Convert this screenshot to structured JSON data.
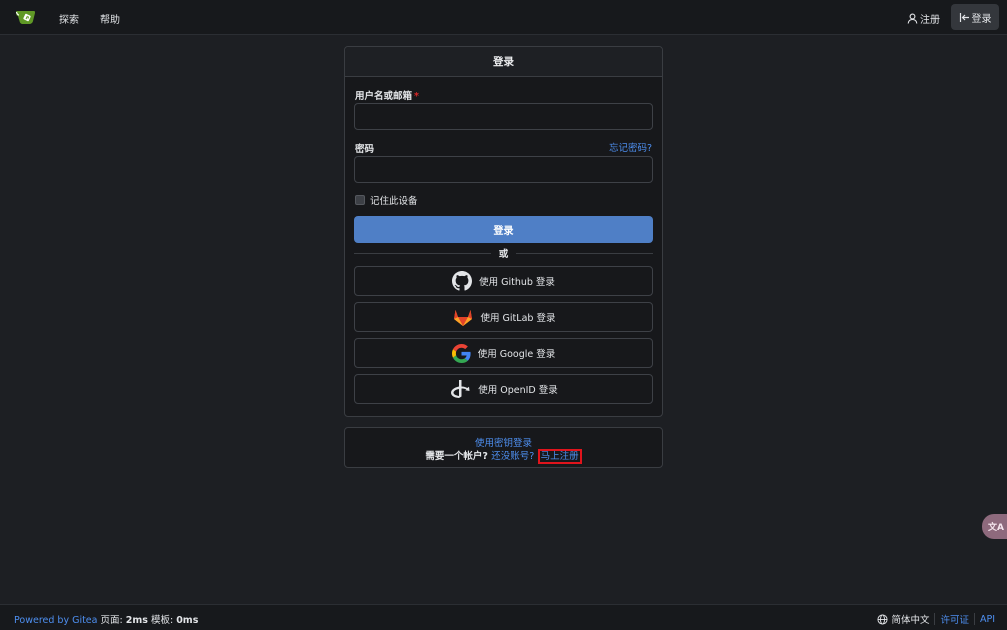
{
  "nav": {
    "explore": "探索",
    "help": "帮助",
    "register": "注册",
    "login": "登录"
  },
  "login": {
    "title": "登录",
    "username_label": "用户名或邮箱",
    "required_mark": "*",
    "username_value": "",
    "password_label": "密码",
    "password_value": "",
    "forgot_password": "忘记密码?",
    "remember_label": "记住此设备",
    "submit_label": "登录",
    "or": "或",
    "oauth": [
      {
        "label": "使用 Github 登录",
        "icon": "github-icon"
      },
      {
        "label": "使用 GitLab 登录",
        "icon": "gitlab-icon"
      },
      {
        "label": "使用 Google 登录",
        "icon": "google-icon"
      },
      {
        "label": "使用 OpenID 登录",
        "icon": "openid-icon"
      }
    ]
  },
  "signup": {
    "passkey_link": "使用密钥登录",
    "need_account": "需要一个帐户?",
    "no_account": "还没账号?",
    "register_now": "马上注册"
  },
  "translate_badge": "文A",
  "footer": {
    "powered_by": "Powered by Gitea",
    "page_label": "页面:",
    "page_time": "2ms",
    "template_label": "模板:",
    "template_time": "0ms",
    "language": "简体中文",
    "license": "许可证",
    "api": "API"
  },
  "colors": {
    "background": "#1d1f23",
    "primary_button": "#4f7fc6",
    "link": "#4e8ff0",
    "highlight_box": "#e0141c"
  }
}
